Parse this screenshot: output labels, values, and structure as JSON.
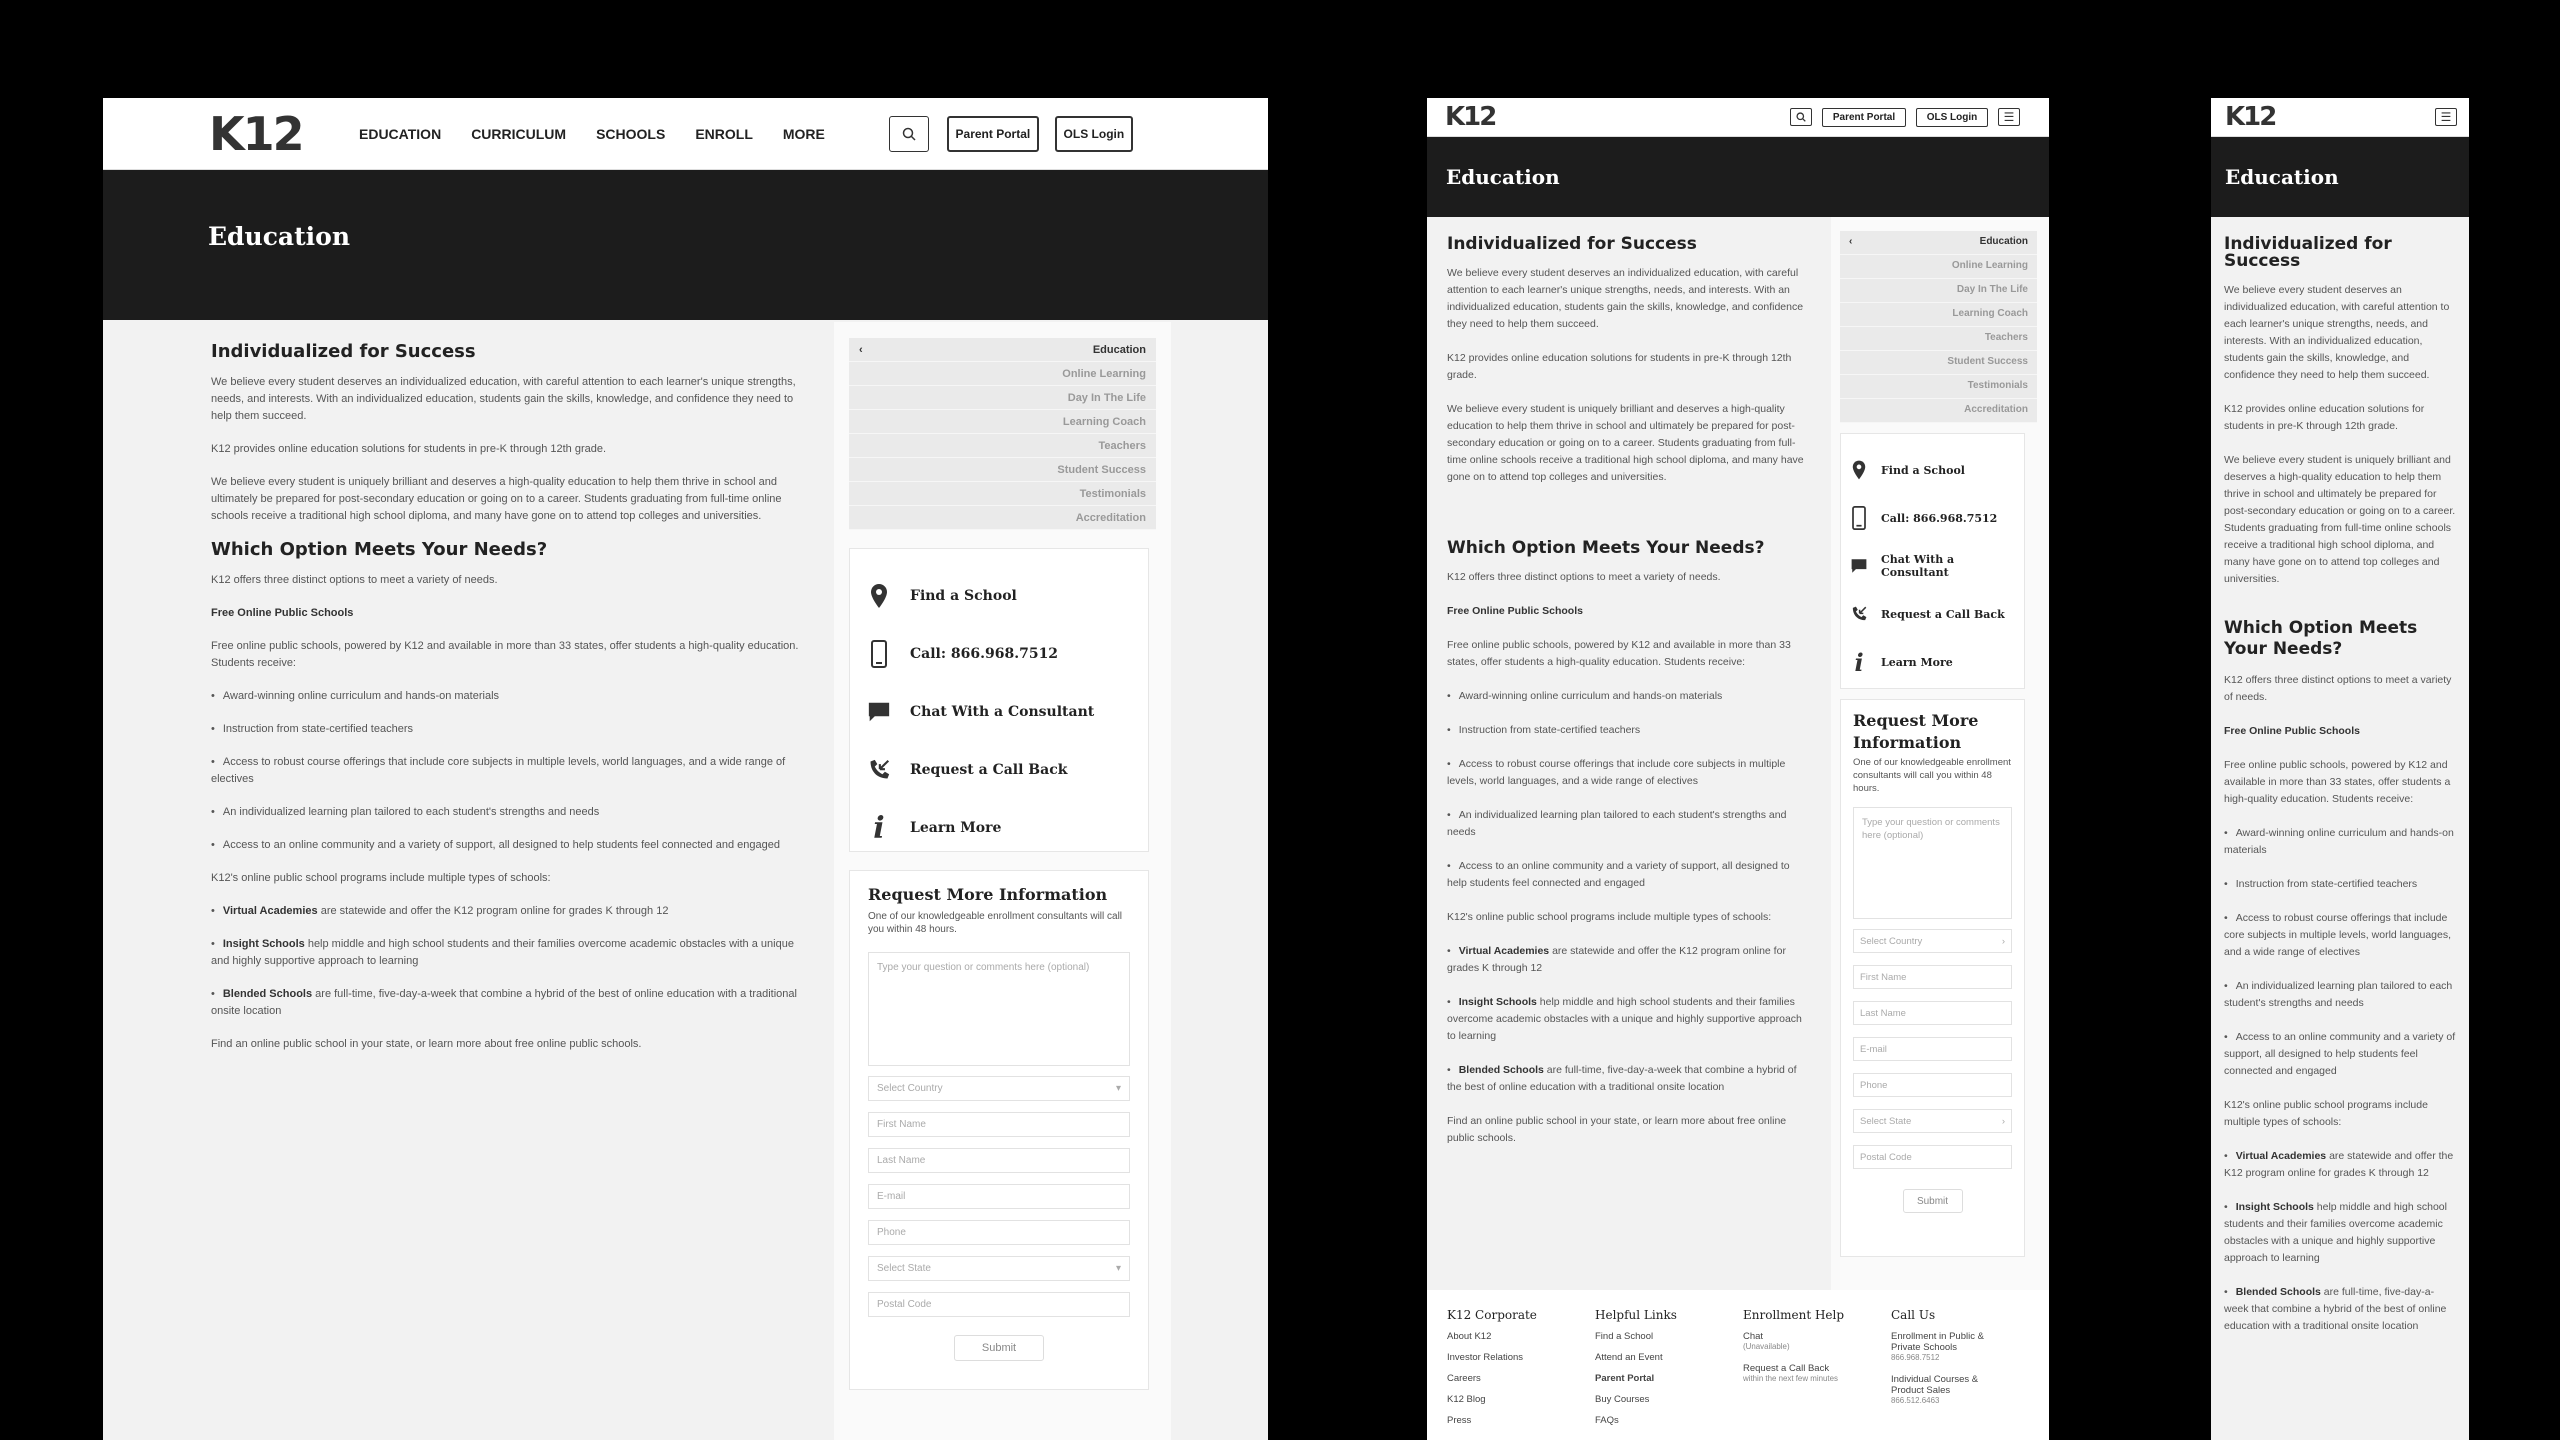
{
  "header": {
    "logo": "K12",
    "nav": [
      "EDUCATION",
      "CURRICULUM",
      "SCHOOLS",
      "ENROLL",
      "MORE"
    ],
    "parent_portal": "Parent Portal",
    "ols_login": "OLS Login"
  },
  "banner": {
    "title": "Education"
  },
  "content": {
    "h1": "Individualized for Success",
    "p1": "We believe every student deserves an individualized education, with careful attention to each learner's unique strengths, needs, and interests. With an individualized education, students gain the skills, knowledge, and confidence they need to help them succeed.",
    "p2": "K12 provides online education solutions for students in pre-K through 12th grade.",
    "p3": "We believe every student is uniquely brilliant and deserves a high-quality education to help them thrive in school and ultimately be prepared for post-secondary education or going on to a career. Students graduating from full-time online schools receive a traditional high school diploma, and many have gone on to attend top colleges and universities.",
    "h2": "Which Option Meets Your Needs?",
    "p4": "K12 offers three distinct options to meet a variety of needs.",
    "free_title": "Free Online Public Schools",
    "p5": "Free online public schools, powered by K12 and available in more than 33 states, offer students a high-quality education. Students receive:",
    "bullets": [
      "Award-winning online curriculum and hands-on materials",
      "Instruction from state-certified teachers",
      "Access to robust course offerings that include core subjects in multiple levels, world languages, and a wide range of electives",
      "An individualized learning plan tailored to each student's strengths and needs",
      "Access to an online community and a variety of support, all designed to help students feel connected and engaged"
    ],
    "p6": "K12's online public school programs include multiple types of schools:",
    "types": [
      {
        "name": "Virtual Academies",
        "text": " are statewide and offer the K12 program online for grades K through 12"
      },
      {
        "name": "Insight Schools",
        "text": " help middle and high school students and their families overcome academic obstacles with a unique and highly supportive approach to learning"
      },
      {
        "name": "Blended Schools",
        "text": " are full-time, five-day-a-week that combine a hybrid of the best of online education with a traditional onsite location"
      }
    ],
    "p7": "Find an online public school in your state, or learn more about free online public schools."
  },
  "sidenav": {
    "items": [
      "Education",
      "Online Learning",
      "Day In The Life",
      "Learning Coach",
      "Teachers",
      "Student Success",
      "Testimonials",
      "Accreditation"
    ]
  },
  "contact": {
    "items": [
      {
        "icon": "map-pin-icon",
        "label": "Find a School"
      },
      {
        "icon": "phone-icon",
        "label": "Call: 866.968.7512"
      },
      {
        "icon": "chat-icon",
        "label": "Chat With a Consultant"
      },
      {
        "icon": "callback-icon",
        "label": "Request a Call Back"
      },
      {
        "icon": "info-icon",
        "label": "Learn More"
      }
    ]
  },
  "form": {
    "title": "Request More Information",
    "title_line1": "Request More",
    "title_line2": "Information",
    "subtitle": "One of our knowledgeable enrollment consultants will call you within 48 hours.",
    "textarea_placeholder": "Type your question or comments here (optional)",
    "country": "Select Country",
    "first": "First Name",
    "last": "Last Name",
    "email": "E-mail",
    "phone": "Phone",
    "state": "Select State",
    "postal": "Postal Code",
    "submit": "Submit"
  },
  "footer": {
    "cols": [
      {
        "title": "K12 Corporate",
        "links": [
          "About K12",
          "Investor Relations",
          "Careers",
          "K12 Blog",
          "Press"
        ]
      },
      {
        "title": "Helpful Links",
        "links": [
          "Find a School",
          "Attend an Event",
          "Parent Portal",
          "Buy Courses",
          "FAQs"
        ]
      },
      {
        "title": "Enrollment Help",
        "links": [
          "Chat",
          "Request a Call Back"
        ],
        "notes": [
          "(Unavailable)",
          "within the next few minutes"
        ]
      },
      {
        "title": "Call Us",
        "links": [
          "Enrollment in Public & Private Schools",
          "Individual Courses & Product Sales"
        ],
        "notes": [
          "866.968.7512",
          "866.512.6463"
        ]
      }
    ]
  }
}
